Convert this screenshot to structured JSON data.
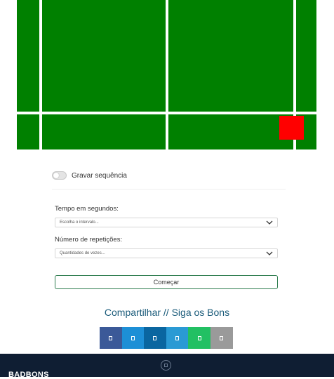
{
  "colors": {
    "court": "#008000",
    "court_lines": "#ffffff",
    "marker": "#ff0000",
    "accent": "#2e7d4f",
    "share_title": "#1a5b7a",
    "footer_bg": "#0f1e33"
  },
  "court": {
    "marker_zone": "bottom-right"
  },
  "record": {
    "label": "Gravar sequência",
    "enabled": false
  },
  "form": {
    "time_label": "Tempo em segundos:",
    "time_placeholder": "Escolha o intervalo...",
    "reps_label": "Número de repetições:",
    "reps_placeholder": "Quantidades de vezes...",
    "start_label": "Começar"
  },
  "share": {
    "title": "Compartilhar // Siga os Bons",
    "buttons": [
      {
        "icon": "facebook-icon",
        "color": "#3b5998"
      },
      {
        "icon": "twitter-icon",
        "color": "#1d8fd6"
      },
      {
        "icon": "linkedin-icon",
        "color": "#0a66a0"
      },
      {
        "icon": "telegram-icon",
        "color": "#2a9ad4"
      },
      {
        "icon": "whatsapp-icon",
        "color": "#22c063"
      },
      {
        "icon": "email-icon",
        "color": "#9a9a9a"
      }
    ]
  },
  "footer": {
    "brand": "BADBONS",
    "icon": "scroll-top-icon"
  }
}
